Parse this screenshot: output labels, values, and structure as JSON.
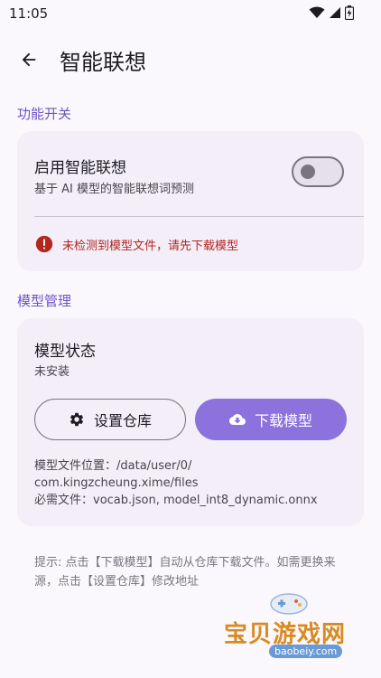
{
  "status_bar": {
    "time": "11:05",
    "icons": [
      "wifi-icon",
      "signal-icon",
      "battery-icon"
    ]
  },
  "app_bar": {
    "title": "智能联想",
    "back_icon": "arrow-left-icon"
  },
  "feature_section": {
    "header": "功能开关",
    "toggle": {
      "title": "启用智能联想",
      "subtitle": "基于 AI 模型的智能联想词预测",
      "enabled": false
    },
    "warning": "未检测到模型文件，请先下载模型"
  },
  "model_section": {
    "header": "模型管理",
    "status_title": "模型状态",
    "status_value": "未安装",
    "buttons": {
      "settings_label": "设置仓库",
      "download_label": "下载模型"
    },
    "file_location_line1": "模型文件位置：/data/user/0/",
    "file_location_line2": "com.kingzcheung.xime/files",
    "required_files": "必需文件：vocab.json, model_int8_dynamic.onnx"
  },
  "hint": "提示: 点击【下载模型】自动从仓库下载文件。如需更换来源，点击【设置仓库】修改地址",
  "watermark": {
    "text": "宝贝游戏网",
    "url": "baobeiy.com"
  },
  "colors": {
    "accent": "#6d53c4",
    "primary_button": "#8b72dc",
    "error": "#b3261e",
    "card": "#f3eef8",
    "background": "#fbf8fd"
  }
}
